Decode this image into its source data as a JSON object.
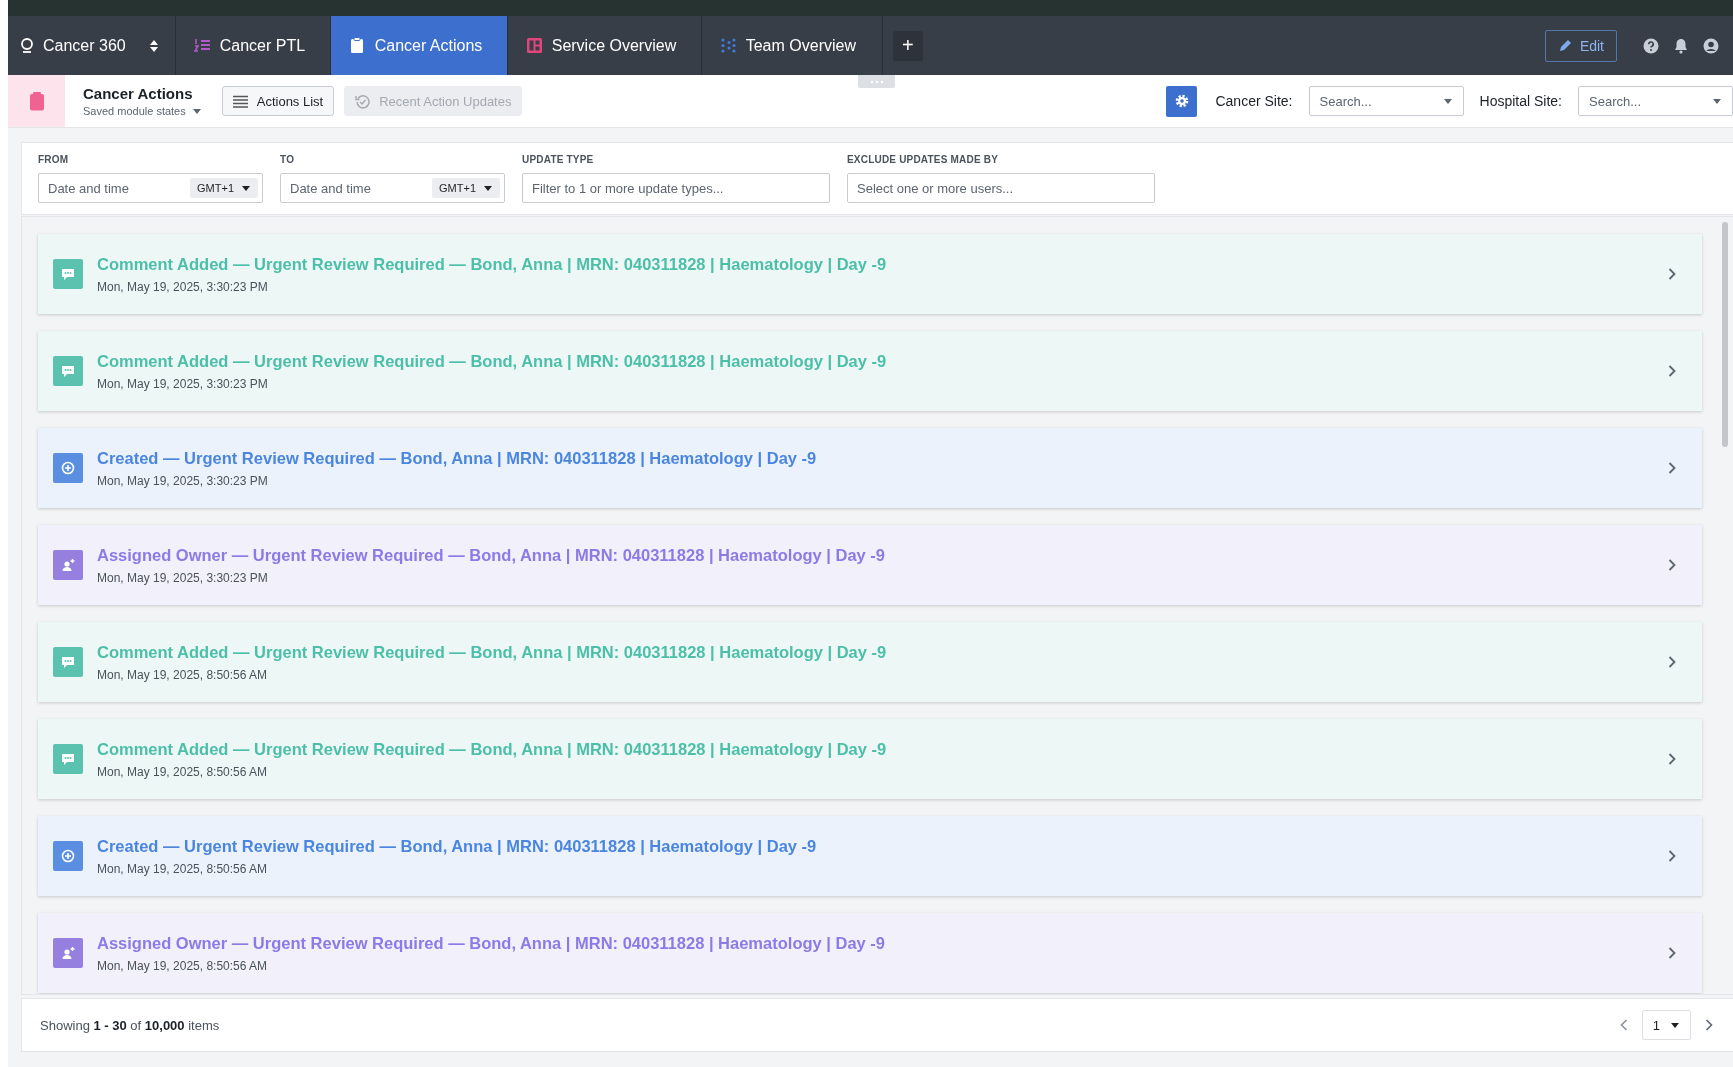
{
  "app_switcher": {
    "label": "Cancer 360"
  },
  "tabs": [
    {
      "label": "Cancer PTL",
      "kind": "ptl",
      "selected": false
    },
    {
      "label": "Cancer Actions",
      "kind": "actions",
      "selected": true
    },
    {
      "label": "Service Overview",
      "kind": "service",
      "selected": false
    },
    {
      "label": "Team Overview",
      "kind": "team",
      "selected": false
    }
  ],
  "add_tab": "+",
  "edit_button": "Edit",
  "module": {
    "title": "Cancer Actions",
    "saved_states": "Saved module states"
  },
  "view_buttons": [
    {
      "label": "Actions List",
      "kind": "list",
      "disabled": false
    },
    {
      "label": "Recent Action Updates",
      "kind": "history",
      "disabled": true
    }
  ],
  "site_filters": [
    {
      "label": "Cancer Site:",
      "placeholder": "Search..."
    },
    {
      "label": "Hospital Site:",
      "placeholder": "Search..."
    }
  ],
  "filters": [
    {
      "label": "FROM",
      "kind": "datetime",
      "placeholder": "Date and time",
      "timezone": "GMT+1"
    },
    {
      "label": "TO",
      "kind": "datetime",
      "placeholder": "Date and time",
      "timezone": "GMT+1"
    },
    {
      "label": "UPDATE TYPE",
      "kind": "text",
      "placeholder": "Filter to 1 or more update types..."
    },
    {
      "label": "EXCLUDE UPDATES MADE BY",
      "kind": "text",
      "placeholder": "Select one or more users..."
    }
  ],
  "updates": [
    {
      "kind": "comment",
      "title": "Comment Added — Urgent Review Required — Bond, Anna | MRN: 040311828 | Haematology | Day -9",
      "time": "Mon, May 19, 2025, 3:30:23 PM"
    },
    {
      "kind": "comment",
      "title": "Comment Added — Urgent Review Required — Bond, Anna | MRN: 040311828 | Haematology | Day -9",
      "time": "Mon, May 19, 2025, 3:30:23 PM"
    },
    {
      "kind": "created",
      "title": "Created — Urgent Review Required — Bond, Anna | MRN: 040311828 | Haematology | Day -9",
      "time": "Mon, May 19, 2025, 3:30:23 PM"
    },
    {
      "kind": "assigned",
      "title": "Assigned Owner — Urgent Review Required — Bond, Anna | MRN: 040311828 | Haematology | Day -9",
      "time": "Mon, May 19, 2025, 3:30:23 PM"
    },
    {
      "kind": "comment",
      "title": "Comment Added — Urgent Review Required — Bond, Anna | MRN: 040311828 | Haematology | Day -9",
      "time": "Mon, May 19, 2025, 8:50:56 AM"
    },
    {
      "kind": "comment",
      "title": "Comment Added — Urgent Review Required — Bond, Anna | MRN: 040311828 | Haematology | Day -9",
      "time": "Mon, May 19, 2025, 8:50:56 AM"
    },
    {
      "kind": "created",
      "title": "Created — Urgent Review Required — Bond, Anna | MRN: 040311828 | Haematology | Day -9",
      "time": "Mon, May 19, 2025, 8:50:56 AM"
    },
    {
      "kind": "assigned",
      "title": "Assigned Owner — Urgent Review Required — Bond, Anna | MRN: 040311828 | Haematology | Day -9",
      "time": "Mon, May 19, 2025, 8:50:56 AM"
    }
  ],
  "pagination": {
    "summary": "Showing **1 - 30** of **10,000** items",
    "page": "1"
  }
}
